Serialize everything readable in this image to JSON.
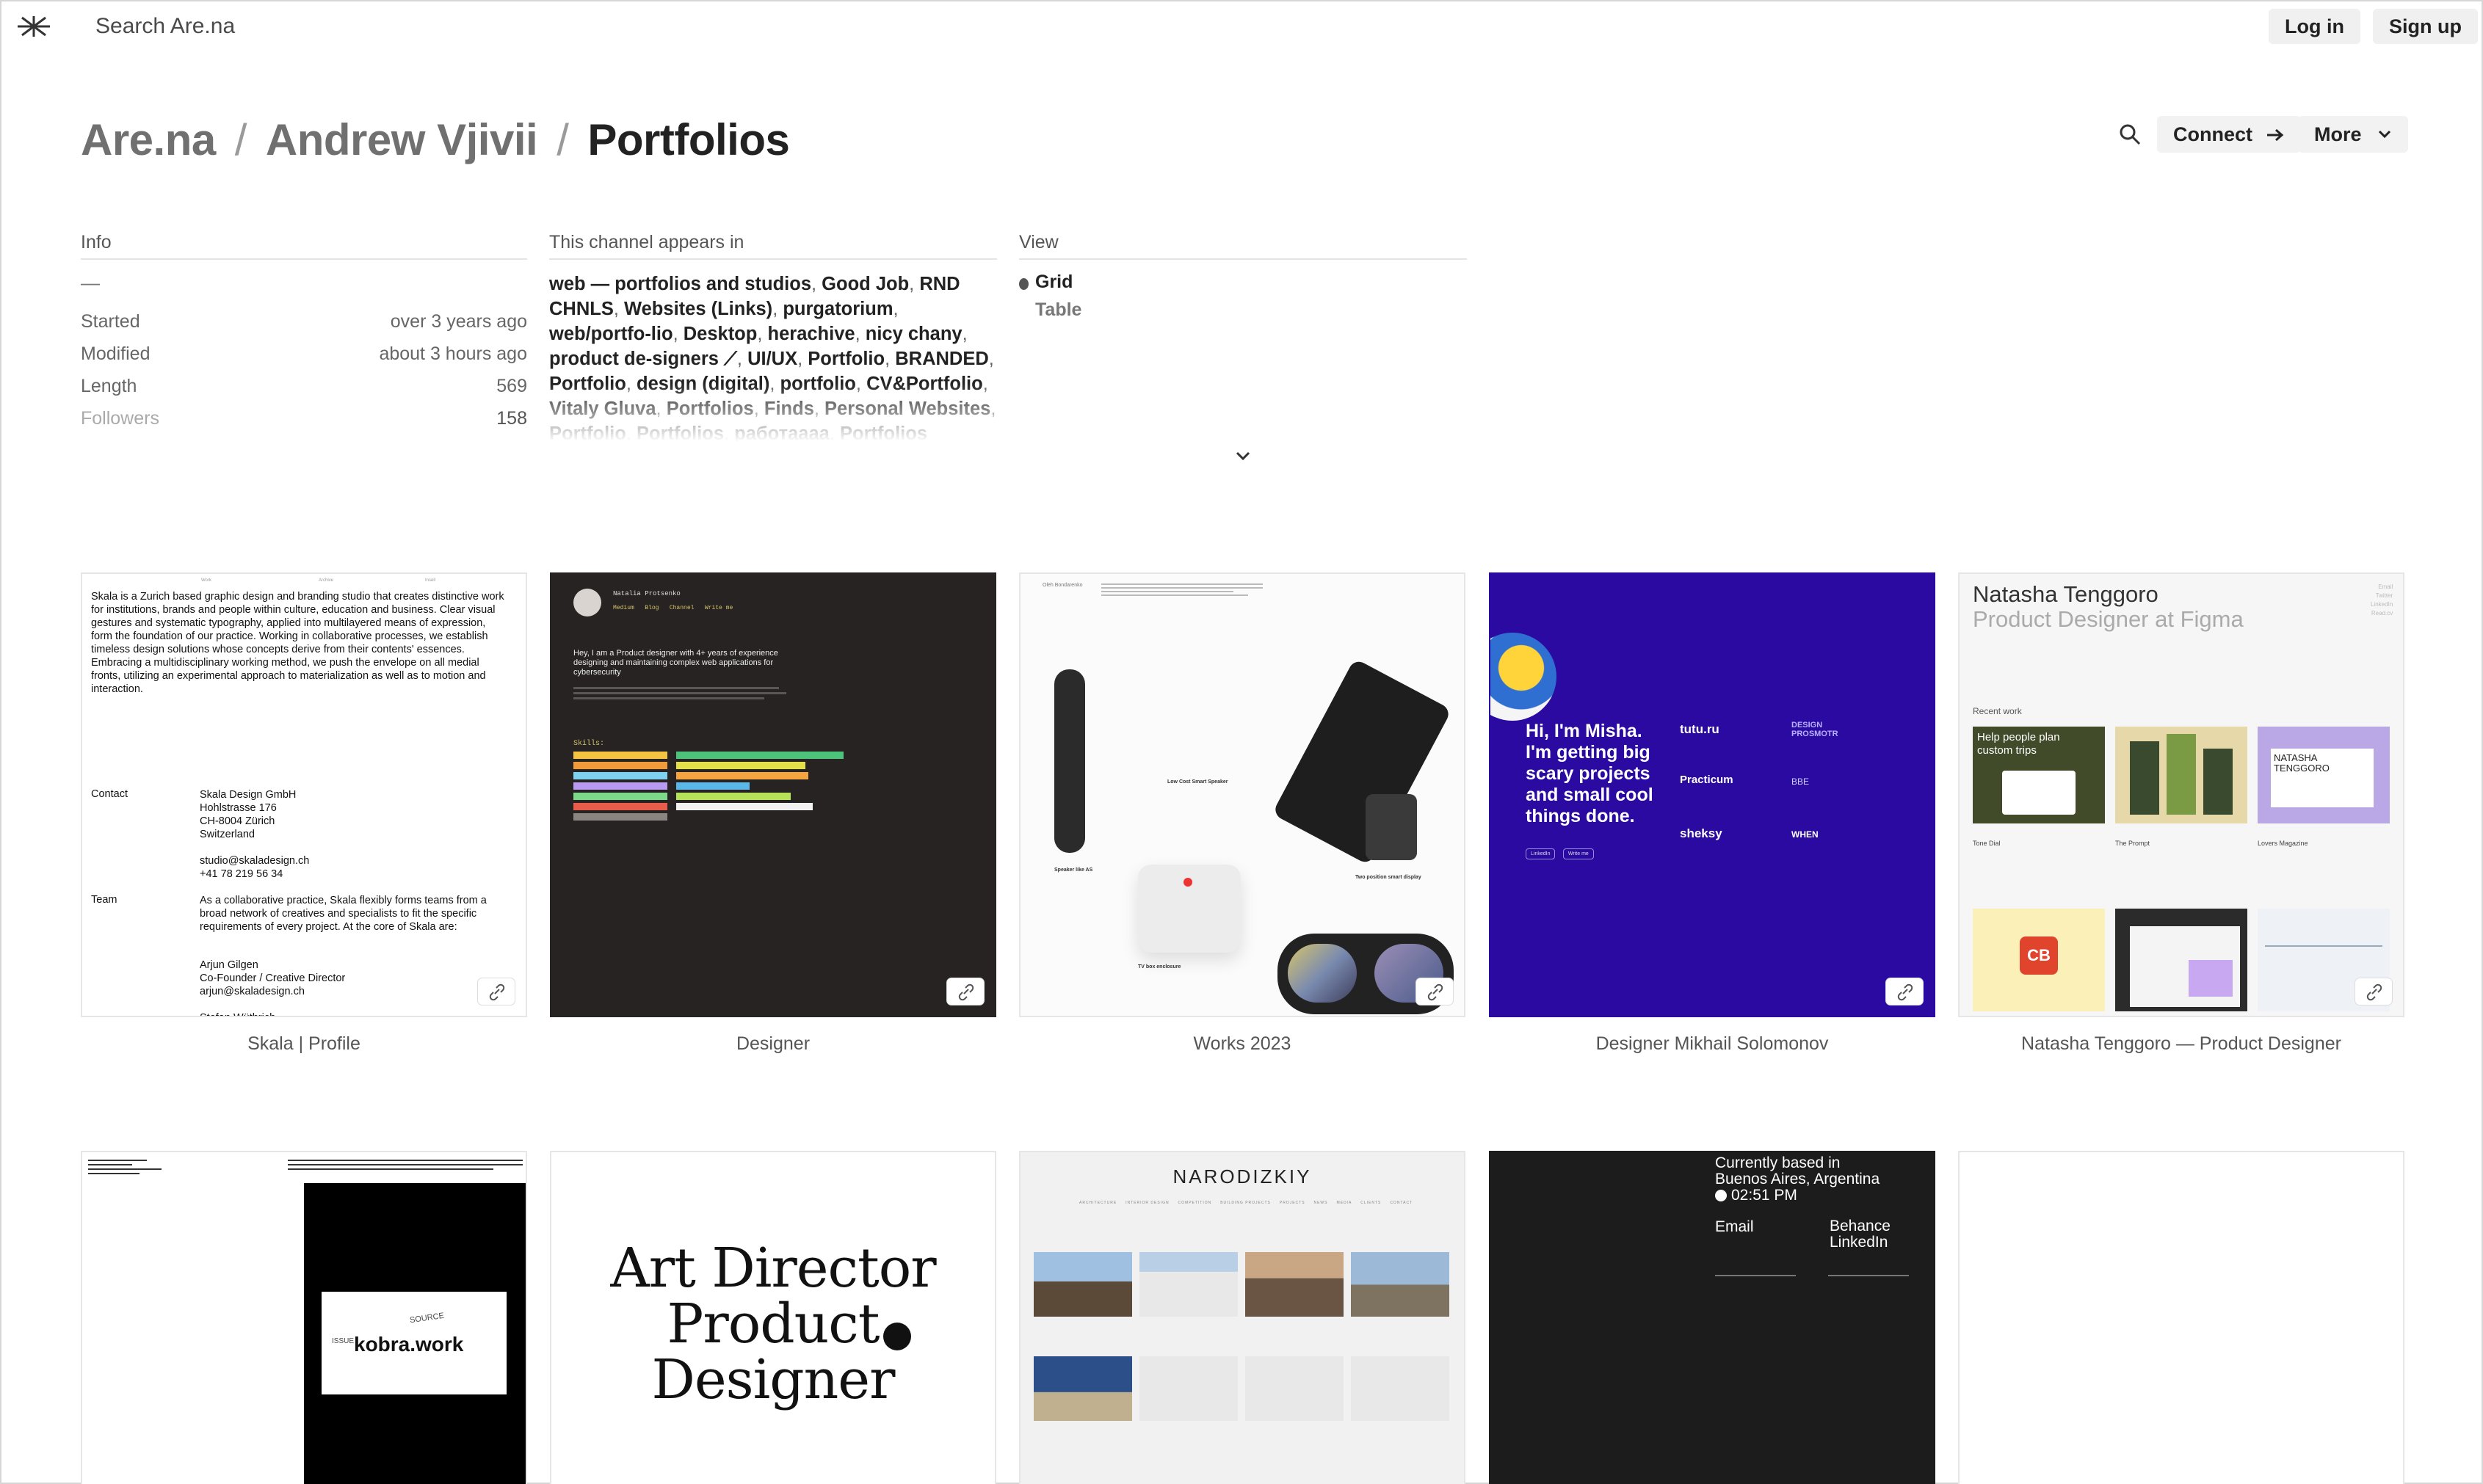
{
  "app": {
    "search_placeholder": "Search Are.na",
    "login": "Log in",
    "signup": "Sign up"
  },
  "breadcrumb": [
    "Are.na",
    "Andrew Vjivii",
    "Portfolios"
  ],
  "actions": {
    "connect": "Connect",
    "more": "More"
  },
  "info": {
    "heading": "Info",
    "dash": "—",
    "rows": [
      {
        "key": "Started",
        "value": "over 3 years ago"
      },
      {
        "key": "Modified",
        "value": "about 3 hours ago"
      },
      {
        "key": "Length",
        "value": "569"
      },
      {
        "key": "Followers",
        "value": "158"
      }
    ]
  },
  "appears_in": {
    "heading": "This channel appears in",
    "channels": [
      "web — portfolios and studios",
      "Good Job",
      "RND CHNLS",
      "Websites (Links)",
      "purgatorium",
      "web/portfo-lio",
      "Desktop",
      "herachive",
      "nicy chany",
      "product de-signers ⟋",
      "UI/UX",
      "Portfolio",
      "BRANDED",
      "Portfolio",
      "design (digital)",
      "portfolio",
      "CV&Portfolio",
      "Vitaly Gluva",
      "Portfolios",
      "Finds",
      "Personal Websites",
      "Portfolio",
      "Portfolios",
      "работаааа",
      "Portfolios"
    ]
  },
  "view": {
    "heading": "View",
    "options": [
      "Grid",
      "Table"
    ],
    "selected": "Grid"
  },
  "blocks": [
    {
      "title": "Skala | Profile"
    },
    {
      "title": "Designer"
    },
    {
      "title": "Works 2023"
    },
    {
      "title": "Designer Mikhail Solomonov"
    },
    {
      "title": "Natasha Tenggoro — Product Designer"
    }
  ],
  "thumbs": {
    "skala": {
      "nav": [
        "Work",
        "Archive",
        "Insell"
      ],
      "intro": "Skala is a Zurich based graphic design and branding studio that creates distinctive work for institutions, brands and people within culture, education and business. Clear visual gestures and systematic typography, applied into multilayered means of expression, form the foundation of our practice. Working in collaborative processes, we establish timeless design solutions whose concepts derive from their contents' essences. Embracing a multidisciplinary working method, we push the envelope on all medial fronts, utilizing an experimental approach to materialization as well as to motion and interaction.",
      "contact_label": "Contact",
      "address": [
        "Skala Design GmbH",
        "Hohlstrasse 176",
        "CH-8004 Zürich",
        "Switzerland"
      ],
      "contact": [
        "studio@skaladesign.ch",
        "+41 78 219 56 34"
      ],
      "team_label": "Team",
      "team": "As a collaborative practice, Skala flexibly forms teams from a broad network of creatives and specialists to fit the specific requirements of every project. At the core of Skala are:",
      "people": [
        "Arjun Gilgen",
        "Co-Founder / Creative Director",
        "arjun@skaladesign.ch"
      ],
      "cut": "Stefan Wüthrich"
    },
    "natalia": {
      "name": "Natalia Protsenko",
      "links": [
        "Medium",
        "Blog",
        "Channel",
        "Write me"
      ],
      "intro": "Hey, I am a Product designer with 4+ years of experience designing and maintaining complex web applications for cybersecurity",
      "skills_label": "Skills:"
    },
    "works": {
      "name": "Oleh Bondarenko",
      "labels": [
        "Low Cost Smart Speaker",
        "Speaker like AS",
        "Two position smart display",
        "TV box enclosure"
      ]
    },
    "misha": {
      "hello": "Hi, I'm Misha. I'm getting big scary projects and small cool things done.",
      "brands": [
        "tutu.ru",
        "DESIGN PROSMOTR",
        "Practicum",
        "BBE",
        "sheksy",
        "WHEN"
      ],
      "buttons": [
        "LinkedIn",
        "Write me"
      ]
    },
    "natasha": {
      "name": "Natasha Tenggoro",
      "role": "Product Designer at Figma",
      "side": [
        "Email",
        "Twitter",
        "LinkedIn",
        "Read.cv"
      ],
      "recent": "Recent work",
      "tiles": [
        "Help people plan custom trips",
        "NATASHA TENGGORO",
        "CB"
      ],
      "projects": [
        "Tone Dial",
        "The Prompt",
        "Lovers Magazine"
      ]
    },
    "kobra": {
      "label": "kobra.work",
      "sub": [
        "SOURCE",
        "ISSUE"
      ]
    },
    "artdir": {
      "lines": [
        "Art Director",
        "Product Designer"
      ]
    },
    "narod": {
      "title": "NARODIZKIY",
      "menu": [
        "ARCHITECTURE",
        "INTERIOR DESIGN",
        "COMPETITION",
        "BUILDING PROJECTS",
        "PROJECTS",
        "NEWS",
        "MEDIA",
        "CLIENTS",
        "CONTACT"
      ]
    },
    "baires": {
      "line1": "Currently based in",
      "line2": "Buenos Aires, Argentina",
      "time": "02:51 PM",
      "email": "Email",
      "social": [
        "Behance",
        "LinkedIn"
      ]
    }
  }
}
